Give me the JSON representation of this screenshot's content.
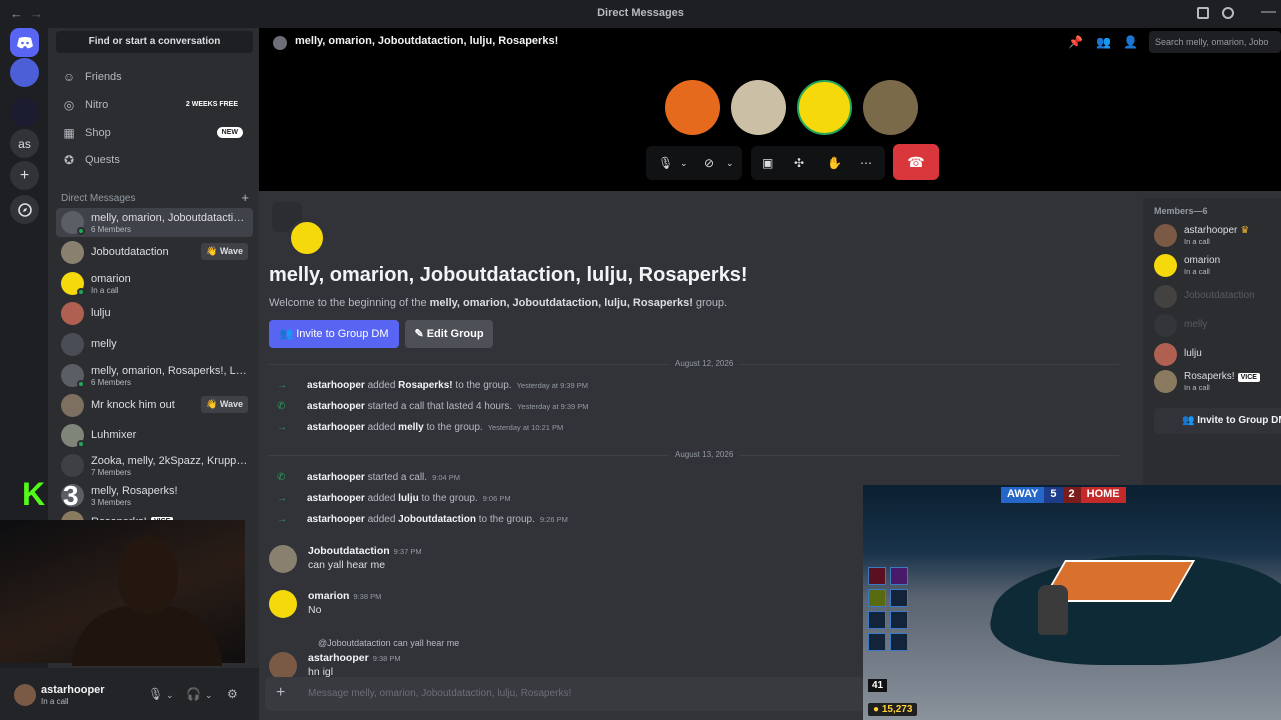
{
  "titlebar": {
    "title": "Direct Messages",
    "back": "←",
    "forward": "→"
  },
  "guilds": {
    "items": [
      {
        "label": "discord-home"
      },
      {
        "label": "server-1"
      },
      {
        "label": "server-2"
      },
      {
        "label": "as"
      },
      {
        "label": "+"
      },
      {
        "label": "explore"
      }
    ]
  },
  "sidebar": {
    "search_label": "Find or start a conversation",
    "nav": [
      {
        "label": "Friends",
        "icon": "friends-icon"
      },
      {
        "label": "Nitro",
        "icon": "nitro-icon",
        "badge": "2 WEEKS FREE"
      },
      {
        "label": "Shop",
        "icon": "shop-icon",
        "badge": "NEW"
      },
      {
        "label": "Quests",
        "icon": "quests-icon"
      }
    ],
    "dm_header": "Direct Messages",
    "dms": [
      {
        "name": "melly, omarion, Joboutdataction, lulju, Rosaperks!",
        "sub": "6 Members",
        "color": "#5c5e66"
      },
      {
        "name": "Joboutdataction",
        "wave": "Wave",
        "color": "#8a8070"
      },
      {
        "name": "omarion",
        "sub": "In a call",
        "color": "#f5d90a"
      },
      {
        "name": "lulju",
        "color": "#b06050"
      },
      {
        "name": "melly",
        "color": "#4a4d55"
      },
      {
        "name": "melly, omarion, Rosaperks!, Luhmixer",
        "sub": "6 Members",
        "color": "#5c5e66"
      },
      {
        "name": "Mr knock him out",
        "wave": "Wave",
        "color": "#7d7060"
      },
      {
        "name": "Luhmixer",
        "color": "#80857a"
      },
      {
        "name": "Zooka, melly, 2kSpazz, Kruppted, Luh...",
        "sub": "7 Members",
        "color": "#3e4046"
      },
      {
        "name": "melly, Rosaperks!",
        "sub": "3 Members",
        "color": "#5c5e66"
      },
      {
        "name": "Rosaperks!",
        "vice": "VICE",
        "color": "#8a7a60"
      }
    ]
  },
  "stream_overlay": {
    "kick_logo": "K",
    "kick_count": "3"
  },
  "user": {
    "name": "astarhooper",
    "status": "In a call"
  },
  "channel": {
    "title": "melly, omarion, Joboutdataction, lulju, Rosaperks!",
    "search_placeholder": "Search melly, omarion, Jobo",
    "intro_title": "melly, omarion, Joboutdataction, lulju, Rosaperks!",
    "intro_prefix": "Welcome to the beginning of the ",
    "intro_group": "melly, omarion, Joboutdataction, lulju, Rosaperks!",
    "intro_suffix": " group.",
    "invite_label": "Invite to Group DM",
    "edit_label": "Edit Group"
  },
  "call": {
    "participants": [
      "#e56a1e",
      "#cbbfa6",
      "#f5d90a",
      "#7b6a4a"
    ]
  },
  "dates": [
    "August 12, 2026",
    "August 13, 2026"
  ],
  "system_messages": [
    {
      "actor": "astarhooper",
      "verb": " added ",
      "target": "Rosaperks!",
      "rest": " to the group.",
      "time": "Yesterday at 9:39 PM",
      "icon": "arrow-icon"
    },
    {
      "actor": "astarhooper",
      "verb": " started a call that lasted 4 hours.",
      "target": "",
      "rest": "",
      "time": "Yesterday at 9:39 PM",
      "icon": "phone-icon"
    },
    {
      "actor": "astarhooper",
      "verb": " added ",
      "target": "melly",
      "rest": " to the group.",
      "time": "Yesterday at 10:21 PM",
      "icon": "arrow-icon"
    },
    {
      "actor": "astarhooper",
      "verb": " started a call.",
      "target": "",
      "rest": "",
      "time": "9:04 PM",
      "icon": "phone-icon"
    },
    {
      "actor": "astarhooper",
      "verb": " added ",
      "target": "lulju",
      "rest": " to the group.",
      "time": "9:06 PM",
      "icon": "arrow-icon"
    },
    {
      "actor": "astarhooper",
      "verb": " added ",
      "target": "Joboutdataction",
      "rest": " to the group.",
      "time": "9:26 PM",
      "icon": "arrow-icon"
    }
  ],
  "messages": [
    {
      "author": "Joboutdataction",
      "time": "9:37 PM",
      "text": "can yall hear me",
      "color": "#8a8070"
    },
    {
      "author": "omarion",
      "time": "9:38 PM",
      "text": "No",
      "color": "#f5d90a"
    },
    {
      "author": "astarhooper",
      "time": "9:38 PM",
      "text": "hn igl",
      "color": "#7a5a44",
      "reply_to": "@Joboutdataction",
      "reply_text": "can yall hear me"
    }
  ],
  "composer_placeholder": "Message melly, omarion, Joboutdataction, lulju, Rosaperks!",
  "members": {
    "header": "Members—6",
    "list": [
      {
        "name": "astarhooper",
        "crown": "♛",
        "status": "In a call",
        "color": "#7a5a44"
      },
      {
        "name": "omarion",
        "status": "In a call",
        "color": "#f5d90a"
      },
      {
        "name": "Joboutdataction",
        "dim": true,
        "color": "#8a8070"
      },
      {
        "name": "melly",
        "dim": true,
        "color": "#4a4d55"
      },
      {
        "name": "lulju",
        "color": "#b06050"
      },
      {
        "name": "Rosaperks!",
        "vice": "VICE",
        "status": "In a call",
        "color": "#8a7a60"
      }
    ],
    "invite_label": "Invite to Group DM"
  },
  "game": {
    "away_label": "AWAY",
    "away_score": "5",
    "home_score": "2",
    "home_label": "HOME",
    "level": "41",
    "coins": "15,273"
  }
}
